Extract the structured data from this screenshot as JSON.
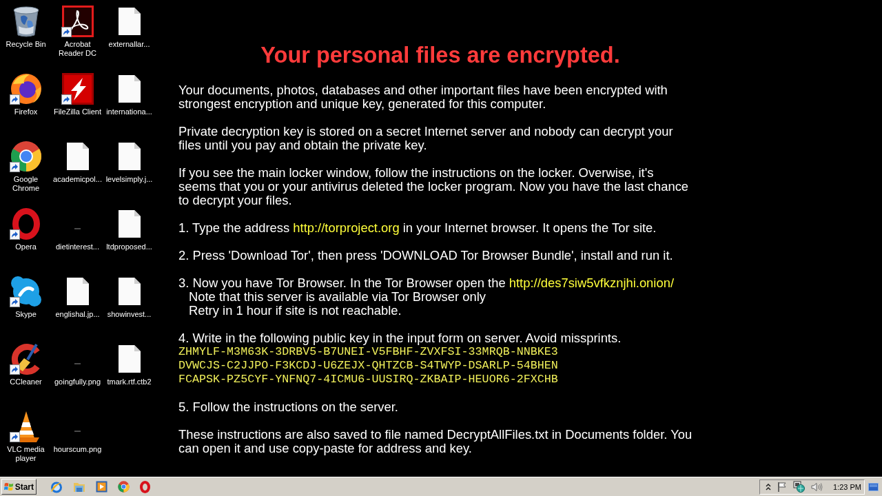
{
  "desktop": {
    "icons": [
      {
        "label": "Recycle Bin",
        "kind": "bin",
        "shortcut": false
      },
      {
        "label": "Firefox",
        "kind": "firefox",
        "shortcut": true
      },
      {
        "label": "Google Chrome",
        "kind": "chrome",
        "shortcut": true
      },
      {
        "label": "Opera",
        "kind": "opera",
        "shortcut": true
      },
      {
        "label": "Skype",
        "kind": "skype",
        "shortcut": true
      },
      {
        "label": "CCleaner",
        "kind": "ccleaner",
        "shortcut": true
      },
      {
        "label": "VLC media player",
        "kind": "vlc",
        "shortcut": true
      },
      {
        "label": "Acrobat Reader DC",
        "kind": "acrobat",
        "shortcut": true
      },
      {
        "label": "FileZilla Client",
        "kind": "filezilla",
        "shortcut": true
      },
      {
        "label": "academicpol...",
        "kind": "document",
        "shortcut": false
      },
      {
        "label": "dietinterest...",
        "kind": "image",
        "shortcut": false
      },
      {
        "label": "englishal.jp...",
        "kind": "document",
        "shortcut": false
      },
      {
        "label": "goingfully.png",
        "kind": "image",
        "shortcut": false
      },
      {
        "label": "hourscum.png",
        "kind": "image",
        "shortcut": false
      },
      {
        "label": "externallar...",
        "kind": "document",
        "shortcut": false
      },
      {
        "label": "internationa...",
        "kind": "document",
        "shortcut": false
      },
      {
        "label": "levelsimply.j...",
        "kind": "document",
        "shortcut": false
      },
      {
        "label": "ltdproposed...",
        "kind": "document",
        "shortcut": false
      },
      {
        "label": "showinvest...",
        "kind": "document",
        "shortcut": false
      },
      {
        "label": "tmark.rtf.ctb2",
        "kind": "document",
        "shortcut": false
      }
    ]
  },
  "message": {
    "title": "Your personal files are encrypted.",
    "paragraphs": [
      {
        "parts": [
          {
            "kind": "plain",
            "text": "Your documents, photos, databases and other important files have been encrypted with\nstrongest encryption and unique key, generated for this computer."
          }
        ]
      },
      {
        "parts": [
          {
            "kind": "plain",
            "text": "Private decryption key is stored on a secret Internet server and nobody can decrypt your\nfiles until you pay and obtain the private key."
          }
        ]
      },
      {
        "parts": [
          {
            "kind": "plain",
            "text": "If you see the main locker window, follow the instructions on the locker. Overwise, it's\nseems that you or your antivirus deleted the locker program. Now you have the last chance\nto decrypt your files."
          }
        ]
      },
      {
        "parts": [
          {
            "kind": "plain",
            "text": "1. Type the address "
          },
          {
            "kind": "link",
            "text": "http://torproject.org"
          },
          {
            "kind": "plain",
            "text": " in your Internet browser. It opens the Tor site."
          }
        ]
      },
      {
        "parts": [
          {
            "kind": "plain",
            "text": "2. Press 'Download Tor', then press 'DOWNLOAD Tor Browser Bundle', install and run it."
          }
        ]
      },
      {
        "parts": [
          {
            "kind": "plain",
            "text": "3. Now you have Tor Browser. In the Tor Browser open the "
          },
          {
            "kind": "link",
            "text": "http://des7siw5vfkznjhi.onion/"
          }
        ],
        "notes": [
          "Note that this server is available via Tor Browser only",
          "Retry in 1 hour if site is not reachable."
        ]
      },
      {
        "parts": [
          {
            "kind": "plain",
            "text": "4. Write in the following public key in the input form on server. Avoid missprints."
          }
        ],
        "key_lines": [
          "ZHMYLF-M3M63K-3DRBV5-B7UNEI-V5FBHF-ZVXFSI-33MRQB-NNBKE3",
          "DVWCJS-C2JJPO-F3KCDJ-U6ZEJX-QHTZCB-S4TWYP-DSARLP-54BHEN",
          "FCAPSK-PZ5CYF-YNFNQ7-4ICMU6-UUSIRQ-ZKBAIP-HEUOR6-2FXCHB"
        ]
      },
      {
        "parts": [
          {
            "kind": "plain",
            "text": "5. Follow the instructions on the server."
          }
        ]
      },
      {
        "parts": [
          {
            "kind": "plain",
            "text": "These instructions are also saved to file named DecryptAllFiles.txt in Documents folder. You\ncan open it and use copy-paste for address and key."
          }
        ]
      }
    ]
  },
  "taskbar": {
    "start_label": "Start",
    "clock": "1:23 PM"
  }
}
